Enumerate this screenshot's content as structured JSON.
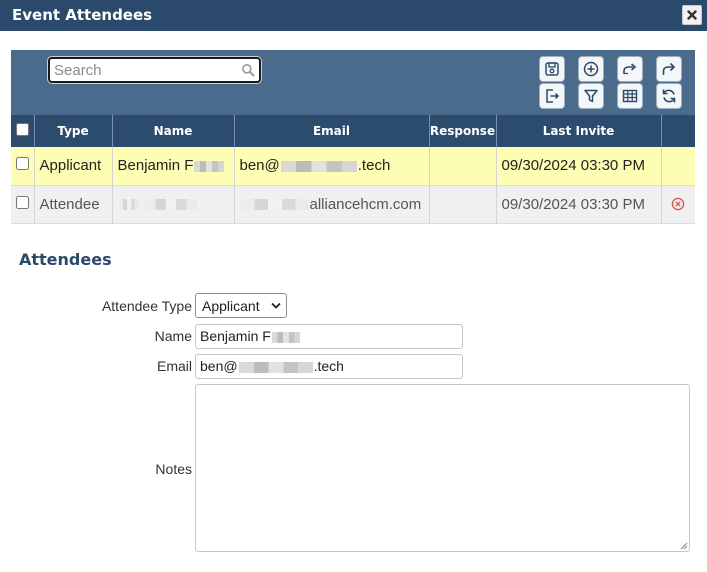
{
  "dialog": {
    "title": "Event Attendees"
  },
  "toolbar": {
    "search_placeholder": "Search",
    "buttons": [
      {
        "icon": "save-icon"
      },
      {
        "icon": "add-circle-icon"
      },
      {
        "icon": "share-icon"
      },
      {
        "icon": "forward-icon"
      },
      {
        "icon": "export-icon"
      },
      {
        "icon": "filter-icon"
      },
      {
        "icon": "grid-icon"
      },
      {
        "icon": "refresh-icon"
      }
    ]
  },
  "table": {
    "columns": [
      "Type",
      "Name",
      "Email",
      "Response",
      "Last Invite"
    ],
    "rows": [
      {
        "type": "Applicant",
        "name_prefix": "Benjamin F",
        "email_prefix": "ben@",
        "email_suffix": ".tech",
        "response": "",
        "last_invite": "09/30/2024 03:30 PM",
        "selected": true
      },
      {
        "type": "Attendee",
        "email_suffix": "alliancehcm.com",
        "response": "",
        "last_invite": "09/30/2024 03:30 PM",
        "selected": false,
        "delete_icon": "remove-circle-icon"
      }
    ]
  },
  "form": {
    "section_title": "Attendees",
    "attendee_type_label": "Attendee Type",
    "attendee_type_value": "Applicant",
    "name_label": "Name",
    "name_value": "Benjamin F",
    "email_label": "Email",
    "email_prefix": "ben@",
    "email_suffix": ".tech",
    "notes_label": "Notes"
  },
  "colors": {
    "titlebar": "#2b4a6b",
    "toolbar": "#4a6b8c",
    "header": "#2c4c6e",
    "selected_row": "#fdfdb3",
    "delete": "#d9534f"
  }
}
